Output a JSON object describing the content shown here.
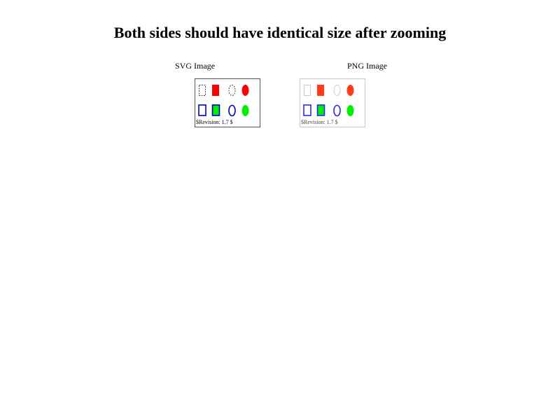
{
  "page": {
    "title": "Both sides should have identical size after zooming"
  },
  "svg_panel": {
    "label": "SVG Image",
    "revision": "$Revision: 1.7 $"
  },
  "png_panel": {
    "label": "PNG Image",
    "revision": "$Revision: 1.7 $"
  },
  "colors": {
    "red": "#ff2a00",
    "blue": "#1a1aff",
    "green": "#00ee00",
    "dashed_outline": "#444444",
    "faded_outline": "#cccccc"
  }
}
